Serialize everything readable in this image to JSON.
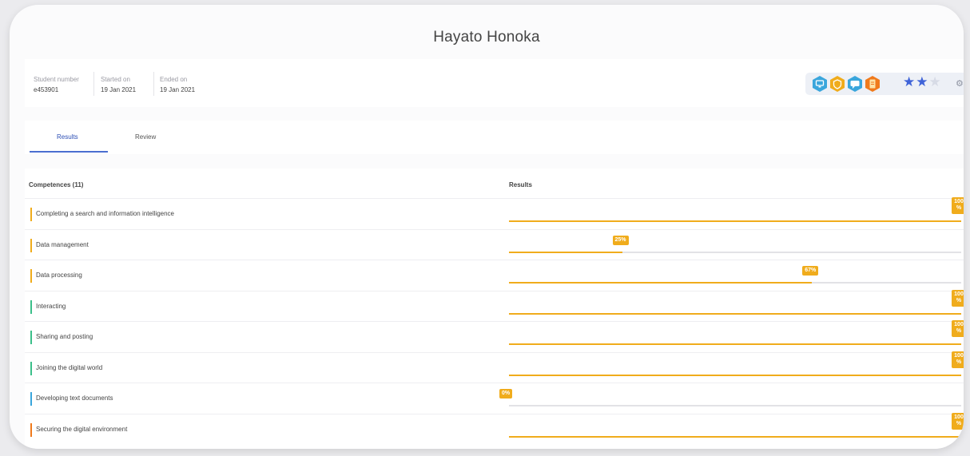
{
  "student": {
    "name": "Hayato Honoka",
    "fields": [
      {
        "label": "Student number",
        "value": "e453901"
      },
      {
        "label": "Started on",
        "value": "19 Jan 2021"
      },
      {
        "label": "Ended on",
        "value": "19 Jan 2021"
      }
    ]
  },
  "badges": [
    {
      "icon": "monitor-badge-icon",
      "color": "#3aa6dc"
    },
    {
      "icon": "shield-badge-icon",
      "color": "#f0ac1c"
    },
    {
      "icon": "chat-badge-icon",
      "color": "#3aa6dc"
    },
    {
      "icon": "document-badge-icon",
      "color": "#f07a1c"
    }
  ],
  "rating": {
    "stars_filled": 2,
    "stars_total": 3
  },
  "tabs": [
    {
      "label": "Results",
      "active": true
    },
    {
      "label": "Review",
      "active": false
    }
  ],
  "table": {
    "col_competences": "Competences (11)",
    "col_results": "Results",
    "rows": [
      {
        "label": "Completing a search and information intelligence",
        "percent": 100,
        "percent_label": "100 %",
        "marker_color": "#f0ac1c"
      },
      {
        "label": "Data management",
        "percent": 25,
        "percent_label": "25%",
        "marker_color": "#f0ac1c"
      },
      {
        "label": "Data processing",
        "percent": 67,
        "percent_label": "67%",
        "marker_color": "#f0ac1c"
      },
      {
        "label": "Interacting",
        "percent": 100,
        "percent_label": "100 %",
        "marker_color": "#3cc08a"
      },
      {
        "label": "Sharing and posting",
        "percent": 100,
        "percent_label": "100 %",
        "marker_color": "#3cc08a"
      },
      {
        "label": "Joining the digital world",
        "percent": 100,
        "percent_label": "100 %",
        "marker_color": "#3cc08a"
      },
      {
        "label": "Developing text documents",
        "percent": 0,
        "percent_label": "0%",
        "marker_color": "#3aa6dc"
      },
      {
        "label": "Securing the digital environment",
        "percent": 100,
        "percent_label": "100 %",
        "marker_color": "#f07a1c"
      }
    ]
  },
  "colors": {
    "accent": "#f0ac1c",
    "tab_active": "#2d4fb5",
    "star": "#3f63d8"
  }
}
